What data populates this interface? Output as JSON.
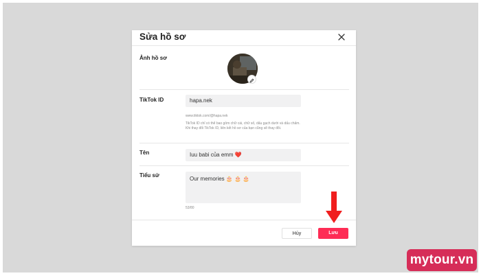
{
  "modal": {
    "title": "Sửa hồ sơ",
    "close_icon": "close-icon",
    "photo_label": "Ảnh hồ sơ",
    "edit_icon": "pencil-icon",
    "tiktok_id": {
      "label": "TikTok ID",
      "value": "hapa.nek",
      "url_hint": "www.tiktok.com/@hapa.nek",
      "help": "TikTok ID chỉ có thể bao gồm chữ cái, chữ số, dấu gạch dưới và dấu chấm. Khi thay đổi TikTok ID, liên kết hồ sơ của bạn cũng sẽ thay đổi."
    },
    "name": {
      "label": "Tên",
      "value": "Iuu babi của emm ❤️"
    },
    "bio": {
      "label": "Tiểu sử",
      "value": "Our memories 🎂 🎂 🎂",
      "counter": "53/80"
    },
    "buttons": {
      "cancel": "Hủy",
      "save": "Lưu"
    }
  },
  "annotation": {
    "arrow_icon": "down-arrow-icon",
    "arrow_color": "#f01e1e"
  },
  "brand": {
    "text": "mytour.vn",
    "color": "#d62d58"
  },
  "colors": {
    "accent": "#fe2c55",
    "backdrop": "#d9d9d9"
  }
}
